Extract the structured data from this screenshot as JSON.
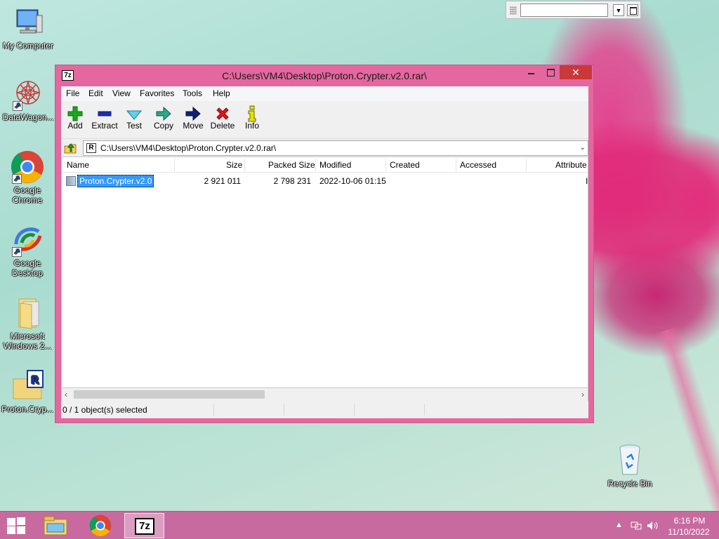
{
  "desktop": {
    "icons": [
      {
        "label": "My Computer"
      },
      {
        "label": "DataWagon..."
      },
      {
        "label": "Google Chrome"
      },
      {
        "label": "Google Desktop"
      },
      {
        "label": "Microsoft Windows 2..."
      },
      {
        "label": "Proton.Cryp..."
      },
      {
        "label": "Recycle Bin"
      }
    ]
  },
  "window": {
    "title": "C:\\Users\\VM4\\Desktop\\Proton.Crypter.v2.0.rar\\",
    "app_icon_text": "7z",
    "close_glyph": "✕",
    "menu": [
      "File",
      "Edit",
      "View",
      "Favorites",
      "Tools",
      "Help"
    ],
    "toolbar": [
      {
        "label": "Add",
        "icon": "plus-icon",
        "color": "#1aa81a"
      },
      {
        "label": "Extract",
        "icon": "minus-icon",
        "color": "#1a2fb0"
      },
      {
        "label": "Test",
        "icon": "check-icon",
        "color": "#2aa8c8"
      },
      {
        "label": "Copy",
        "icon": "copy-arrow-icon",
        "color": "#1f8f7a"
      },
      {
        "label": "Move",
        "icon": "move-arrow-icon",
        "color": "#12207a"
      },
      {
        "label": "Delete",
        "icon": "delete-x-icon",
        "color": "#d81818"
      },
      {
        "label": "Info",
        "icon": "info-icon",
        "color": "#c8c800"
      }
    ],
    "address": {
      "path": "C:\\Users\\VM4\\Desktop\\Proton.Crypter.v2.0.rar\\",
      "icon_text": "R"
    },
    "columns": [
      "Name",
      "Size",
      "Packed Size",
      "Modified",
      "Created",
      "Accessed",
      "Attribute"
    ],
    "rows": [
      {
        "name": "Proton.Crypter.v2.0",
        "size": "2 921 011",
        "packed": "2 798 231",
        "modified": "2022-10-06 01:15",
        "created": "",
        "accessed": "",
        "attr": "I"
      }
    ],
    "status": {
      "selection": "0 / 1 object(s) selected"
    }
  },
  "taskbar": {
    "pinned": [
      "file-explorer",
      "google-chrome",
      "7-zip"
    ],
    "active": "7-zip",
    "seven_zip_text": "7z",
    "clock": {
      "time": "6:16 PM",
      "date": "11/10/2022"
    }
  },
  "colors": {
    "window_frame": "#e5679f",
    "close_button": "#c9393a",
    "selection": "#3399ff",
    "taskbar": "#c86aa0"
  }
}
